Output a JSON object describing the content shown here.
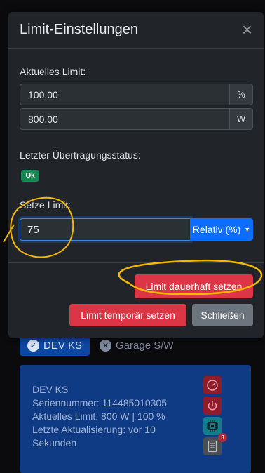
{
  "modal": {
    "title": "Limit-Einstellungen",
    "close_symbol": "×",
    "current_limit_label": "Aktuelles Limit:",
    "limit_percent_value": "100,00",
    "limit_percent_unit": "%",
    "limit_watt_value": "800,00",
    "limit_watt_unit": "W",
    "status_label": "Letzter Übertragungsstatus:",
    "status_badge": "Ok",
    "set_limit_label": "Setze Limit:",
    "set_limit_value": "75",
    "limit_type_button": "Relativ (%)",
    "permanent_button": "Limit dauerhaft setzen",
    "temporary_button": "Limit temporär setzen",
    "close_button": "Schließen"
  },
  "background": {
    "tabs": [
      {
        "label": "DEV KS",
        "icon": "check-circle-icon",
        "active": true
      },
      {
        "label": "Garage S/W",
        "icon": "x-circle-icon",
        "active": false
      }
    ],
    "card": {
      "name": "DEV KS",
      "serial": "Seriennummer: 114485010305",
      "current_limit": "Aktuelles Limit: 800 W | 100 %",
      "last_update": "Letzte Aktualisierung: vor 10 Sekunden",
      "icons": [
        "gauge-icon",
        "power-icon",
        "chip-icon",
        "journal-icon"
      ],
      "journal_badge": "3"
    }
  },
  "colors": {
    "modal_bg": "#212529",
    "primary": "#0d6efd",
    "danger": "#dc3545",
    "secondary": "#6c757d",
    "success": "#198754",
    "annotation": "#f5b800"
  }
}
